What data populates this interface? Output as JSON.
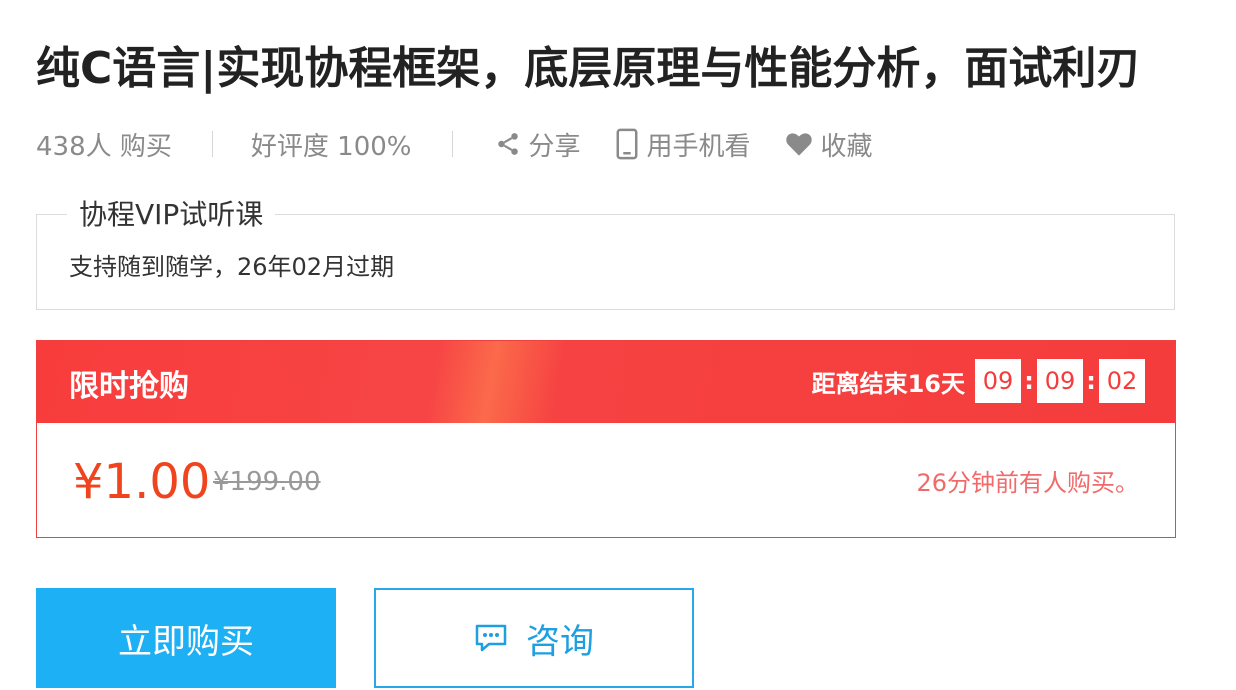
{
  "course": {
    "title": "纯C语言|实现协程框架，底层原理与性能分析，面试利刃"
  },
  "meta": {
    "buyers": "438人 购买",
    "rating": "好评度 100%",
    "actions": [
      {
        "label": "分享",
        "icon": "share-icon"
      },
      {
        "label": "用手机看",
        "icon": "phone-icon"
      },
      {
        "label": "收藏",
        "icon": "heart-icon"
      }
    ]
  },
  "plan": {
    "name": "协程VIP试听课",
    "description": "支持随到随学，26年02月过期"
  },
  "flash_sale": {
    "label": "限时抢购",
    "countdown_prefix": "距离结束16天",
    "hours": "09",
    "minutes": "09",
    "seconds": "02",
    "price": "¥1.00",
    "original_price": "¥199.00",
    "recent_purchase": "26分钟前有人购买。"
  },
  "buttons": {
    "buy": "立即购买",
    "consult": "咨询"
  },
  "colors": {
    "flash_red": "#f53c3c",
    "price_orange": "#f0441e",
    "buy_blue": "#1eb0f5",
    "consult_blue": "#2aa6ea"
  }
}
